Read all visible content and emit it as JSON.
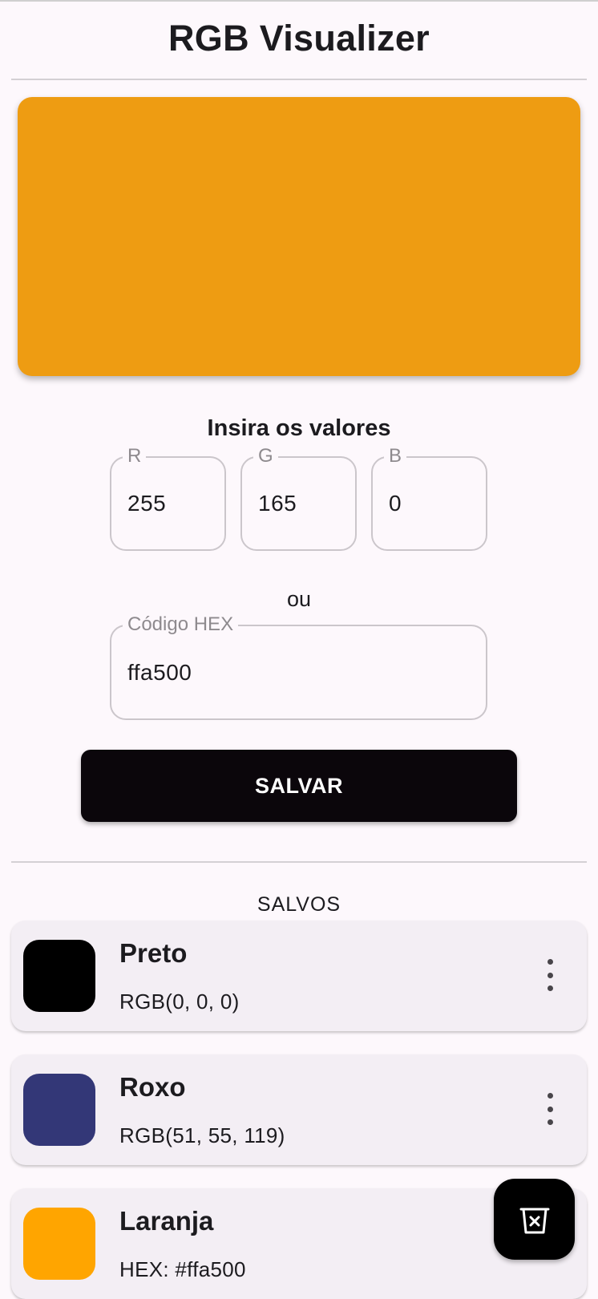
{
  "app": {
    "title": "RGB Visualizer"
  },
  "preview": {
    "color": "#ee9c12"
  },
  "inputs": {
    "section_title": "Insira os valores",
    "r": {
      "label": "R",
      "value": "255"
    },
    "g": {
      "label": "G",
      "value": "165"
    },
    "b": {
      "label": "B",
      "value": "0"
    },
    "or_text": "ou",
    "hex": {
      "label": "Código HEX",
      "value": "ffa500"
    },
    "save_label": "SALVAR"
  },
  "saved": {
    "heading": "SALVOS",
    "items": [
      {
        "name": "Preto",
        "value": "RGB(0, 0, 0)",
        "color": "#000000"
      },
      {
        "name": "Roxo",
        "value": "RGB(51, 55, 119)",
        "color": "#333777"
      },
      {
        "name": "Laranja",
        "value": "HEX: #ffa500",
        "color": "#ffa500"
      }
    ]
  },
  "fab": {
    "icon": "delete-all-icon"
  }
}
